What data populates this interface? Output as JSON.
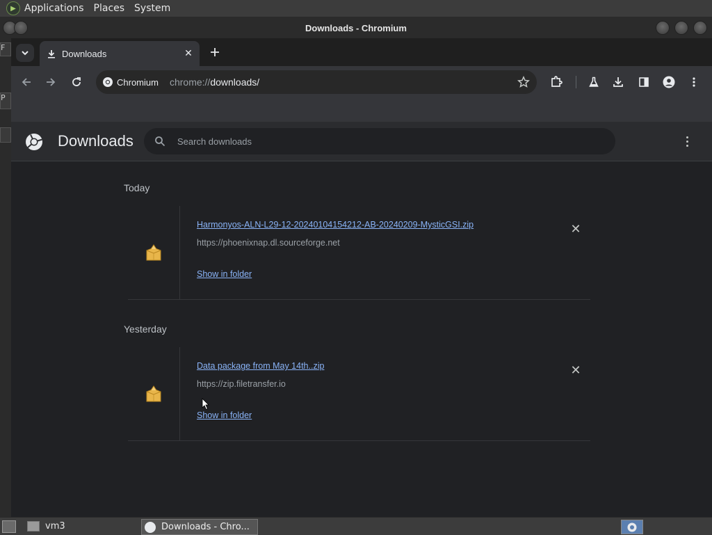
{
  "top_panel": {
    "menus": [
      "Applications",
      "Places",
      "System"
    ]
  },
  "background_window": {
    "tab_letters": [
      "F",
      "P"
    ]
  },
  "window": {
    "title": "Downloads - Chromium"
  },
  "tabs": [
    {
      "title": "Downloads",
      "icon": "download-icon",
      "active": true
    }
  ],
  "toolbar": {
    "site_chip": "Chromium",
    "url_scheme": "chrome://",
    "url_path": "downloads/"
  },
  "page": {
    "title": "Downloads",
    "search_placeholder": "Search downloads"
  },
  "downloads": [
    {
      "date": "Today",
      "items": [
        {
          "filename": "Harmonyos-ALN-L29-12-20240104154212-AB-20240209-MysticGSI.zip",
          "url": "https://phoenixnap.dl.sourceforge.net",
          "action": "Show in folder"
        }
      ]
    },
    {
      "date": "Yesterday",
      "items": [
        {
          "filename": "Data package from May 14th..zip",
          "url": "https://zip.filetransfer.io",
          "action": "Show in folder"
        }
      ]
    }
  ],
  "taskbar": {
    "items": [
      {
        "label": "vm3"
      },
      {
        "label": "Downloads - Chro...",
        "active": true
      }
    ]
  },
  "colors": {
    "accent_link": "#8ab4f8",
    "page_bg": "#202124",
    "toolbar_bg": "#35363a"
  }
}
